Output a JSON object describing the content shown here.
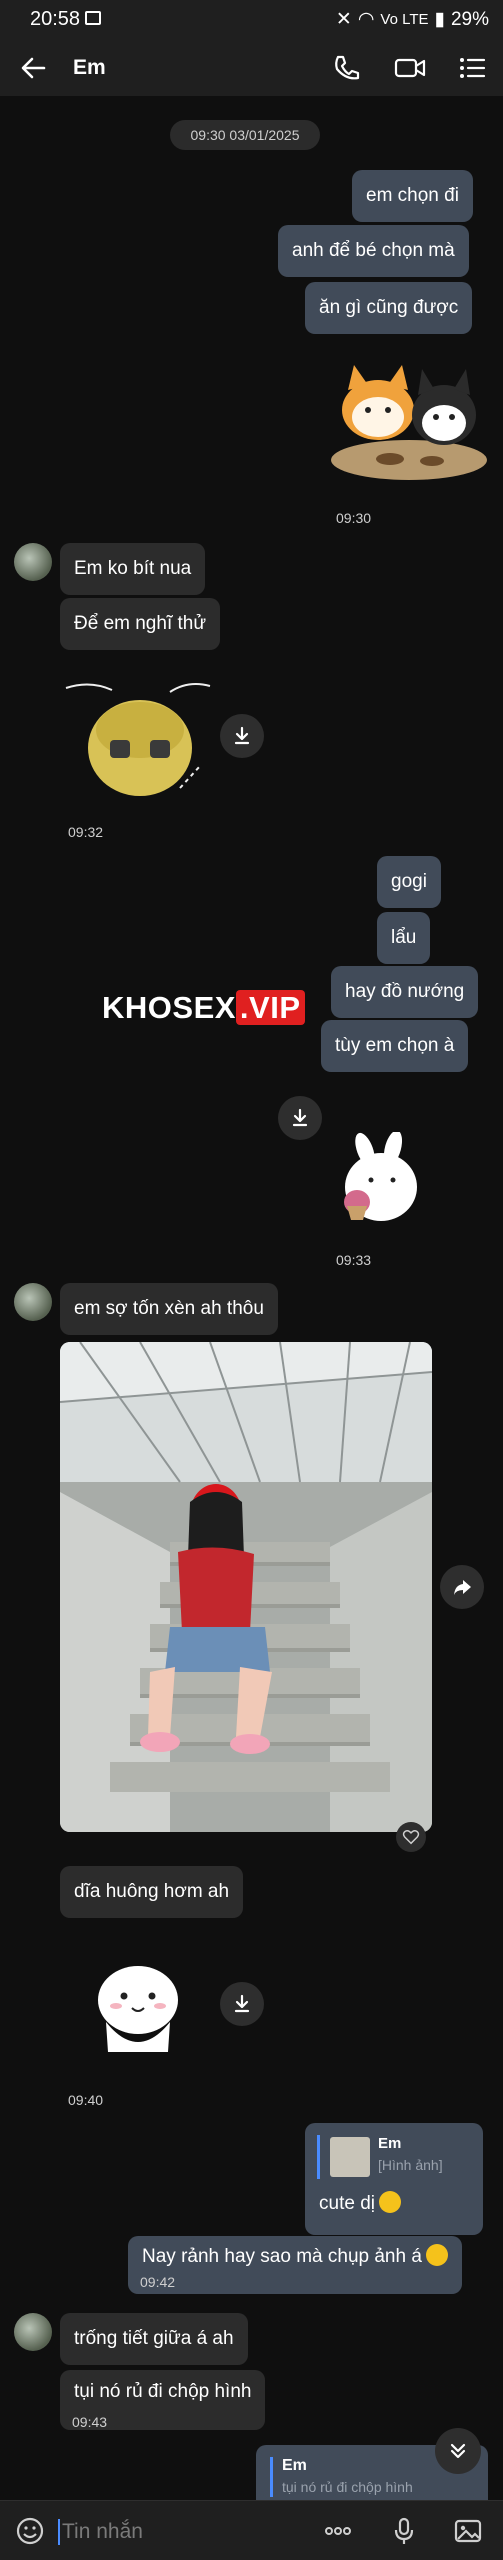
{
  "status_bar": {
    "time": "20:58",
    "battery": "29%",
    "network": "Vo LTE"
  },
  "header": {
    "title": "Em",
    "icons": [
      "back-arrow-icon",
      "phone-icon",
      "video-call-icon",
      "list-menu-icon"
    ]
  },
  "date_separator": "09:30 03/01/2025",
  "messages": {
    "m1": "em chọn đi",
    "m2": "anh để bé chọn mà",
    "m3": "ăn gì cũng được",
    "t1": "09:30",
    "m4": "Em ko bít nua",
    "m5": "Để em nghĩ thử",
    "t2": "09:32",
    "m6": "gogi",
    "m7": "lẩu",
    "m8": "hay đồ nướng",
    "m9": "tùy em chọn à",
    "t3": "09:33",
    "m10": "em sợ tốn xèn ah thôu",
    "m11": "dĩa huông hơm ah",
    "t4": "09:40",
    "reply1": {
      "quoted_name": "Em",
      "quoted_text": "[Hình ảnh]",
      "text": "cute dị"
    },
    "m12": "Nay rảnh hay sao mà chụp ảnh á",
    "t5": "09:42",
    "m13": "trống tiết giữa á ah",
    "m14": "tụi nó rủ đi chộp hình",
    "t6": "09:43",
    "reply2": {
      "quoted_name": "Em",
      "quoted_text": "tụi nó rủ đi chộp hình"
    }
  },
  "watermark": {
    "part1": "KHOSEX",
    "part2": ".VIP"
  },
  "input": {
    "placeholder": "Tin nhắn"
  },
  "colors": {
    "background": "#0f0f0f",
    "outgoing_bubble": "#414b59",
    "incoming_bubble": "#2c2c2c",
    "accent": "#4a8cff"
  }
}
